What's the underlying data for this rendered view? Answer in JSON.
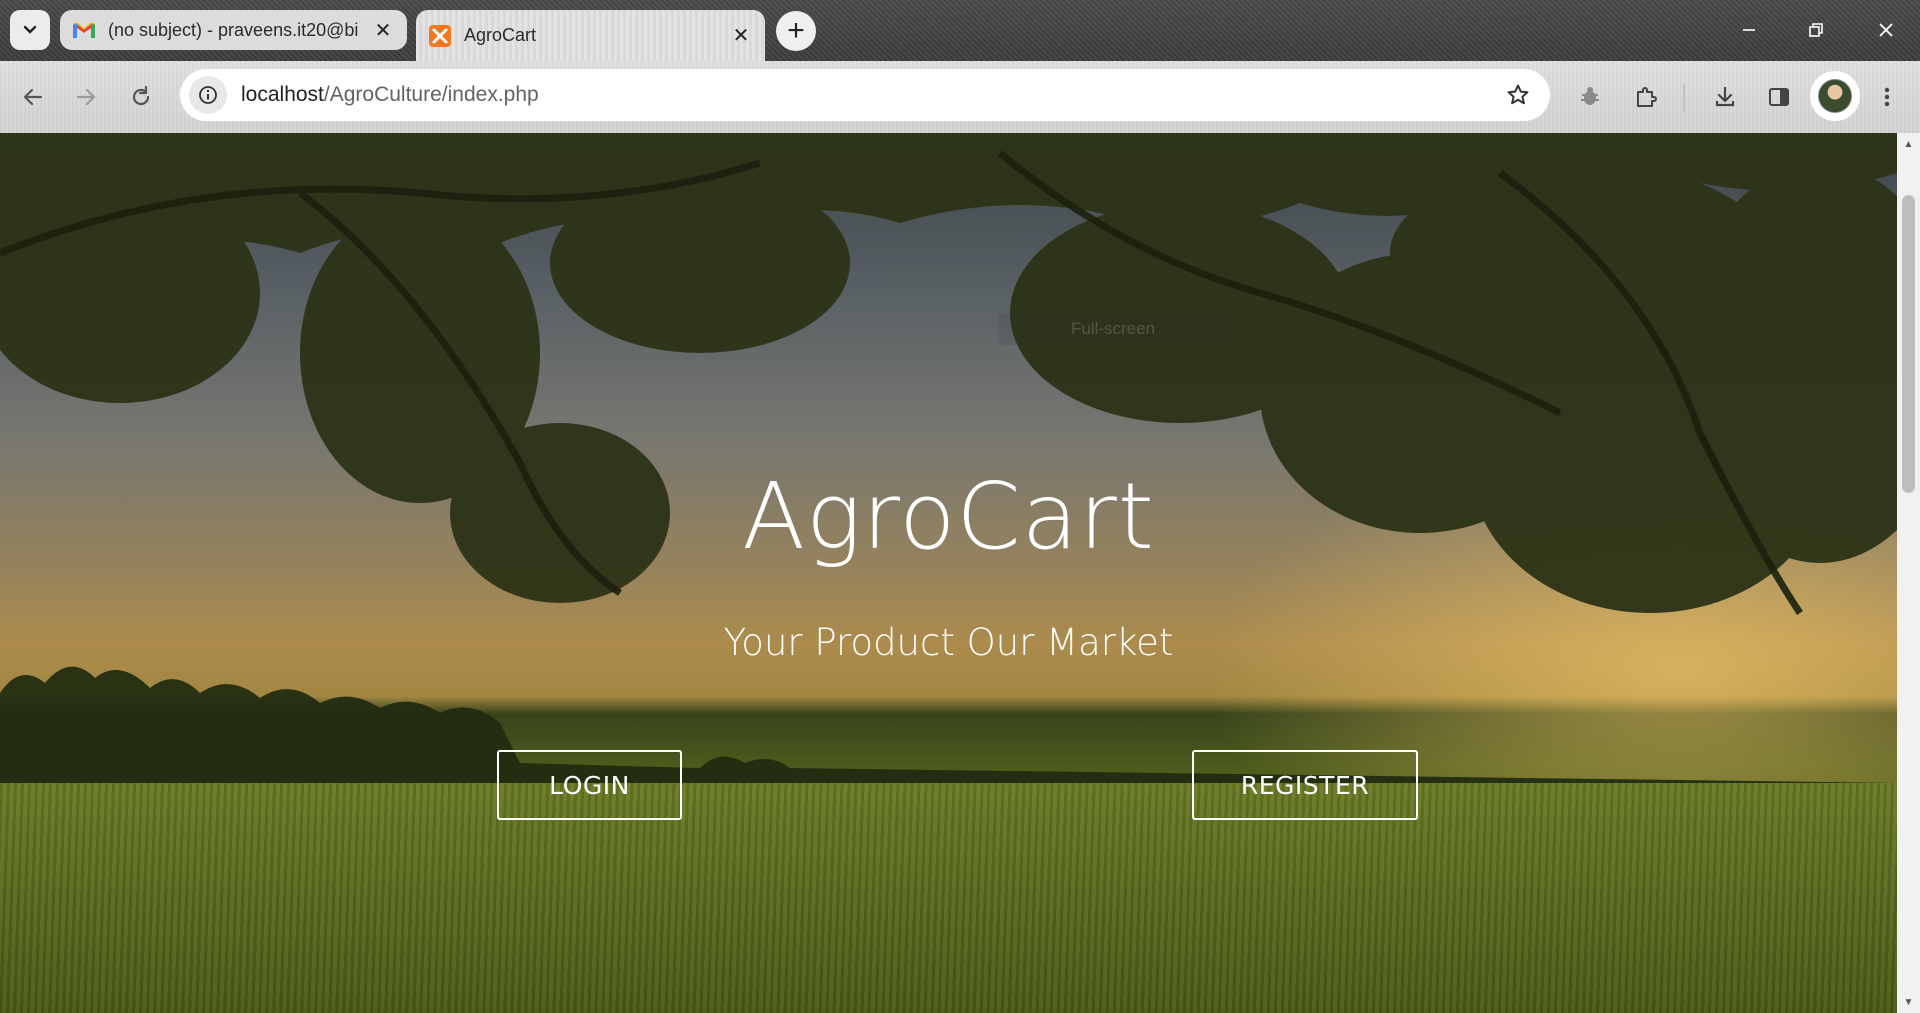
{
  "browser": {
    "tabs": [
      {
        "title": "(no subject) - praveens.it20@bi",
        "favicon": "gmail-icon",
        "active": false
      },
      {
        "title": "AgroCart",
        "favicon": "xampp-icon",
        "active": true
      }
    ],
    "new_tab_label": "+",
    "address": {
      "host": "localhost",
      "path": "/AgroCulture/index.php"
    },
    "window_controls": [
      "minimize-icon",
      "restore-icon",
      "close-icon"
    ],
    "toolbar_icons": [
      "back-icon",
      "forward-icon",
      "reload-icon",
      "site-info-icon",
      "bookmark-star-icon",
      "bug-extension-icon",
      "extensions-puzzle-icon",
      "download-icon",
      "side-panel-icon",
      "profile-avatar",
      "menu-kebab-icon"
    ]
  },
  "page": {
    "title": "AgroCart",
    "subtitle": "Your Product Our Market",
    "login_label": "LOGIN",
    "register_label": "REGISTER",
    "fullscreen_hint": "Full-screen"
  },
  "colors": {
    "hero_text": "#ffffff",
    "tabstrip": "#3c3c3c",
    "toolbar": "#d4d4d4"
  }
}
